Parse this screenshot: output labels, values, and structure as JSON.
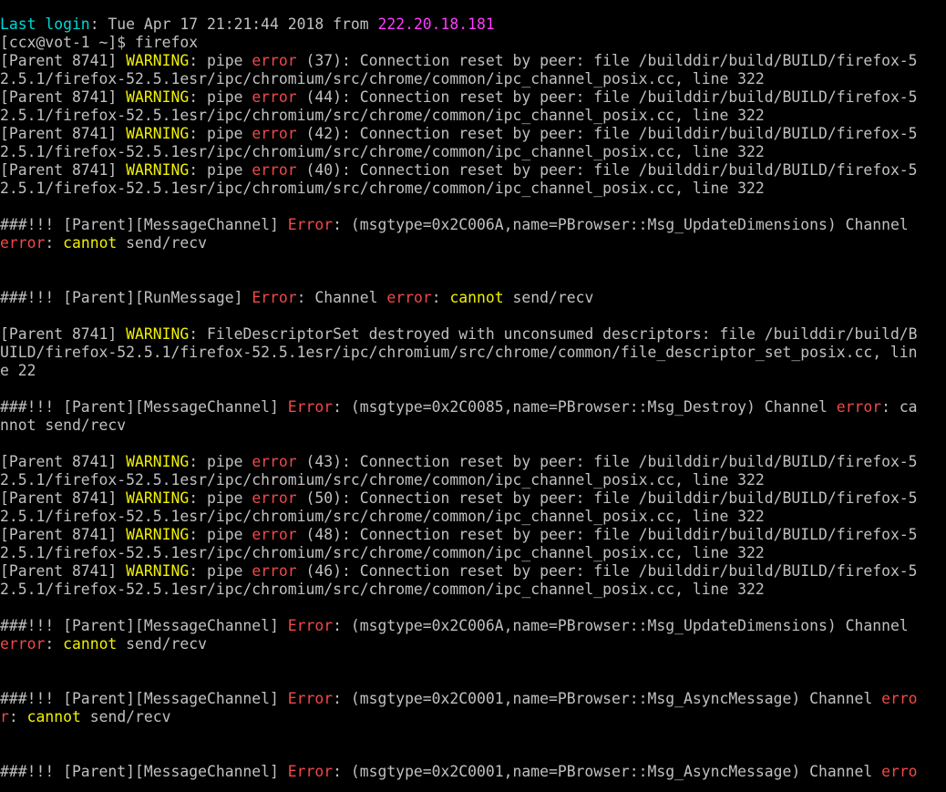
{
  "terminal": {
    "colors": {
      "default": "#c0c0c0",
      "cyan": "#00d7d7",
      "magenta": "#ff3cff",
      "yellow": "#f0f000",
      "red": "#f04848",
      "background": "#000000"
    },
    "lines": [
      [
        [
          "cyan",
          "Last login"
        ],
        [
          "default",
          ": Tue Apr 17 21:21:44 2018 from "
        ],
        [
          "magenta",
          "222.20.18.181"
        ]
      ],
      [
        [
          "default",
          "[ccx@vot-1 ~]$ firefox"
        ]
      ],
      [
        [
          "default",
          "[Parent 8741] "
        ],
        [
          "yellow",
          "WARNING"
        ],
        [
          "default",
          ": pipe "
        ],
        [
          "red",
          "error"
        ],
        [
          "default",
          " (37): Connection reset by peer: file /builddir/build/BUILD/firefox-5"
        ]
      ],
      [
        [
          "default",
          "2.5.1/firefox-52.5.1esr/ipc/chromium/src/chrome/common/ipc_channel_posix.cc, line 322"
        ]
      ],
      [
        [
          "default",
          "[Parent 8741] "
        ],
        [
          "yellow",
          "WARNING"
        ],
        [
          "default",
          ": pipe "
        ],
        [
          "red",
          "error"
        ],
        [
          "default",
          " (44): Connection reset by peer: file /builddir/build/BUILD/firefox-5"
        ]
      ],
      [
        [
          "default",
          "2.5.1/firefox-52.5.1esr/ipc/chromium/src/chrome/common/ipc_channel_posix.cc, line 322"
        ]
      ],
      [
        [
          "default",
          "[Parent 8741] "
        ],
        [
          "yellow",
          "WARNING"
        ],
        [
          "default",
          ": pipe "
        ],
        [
          "red",
          "error"
        ],
        [
          "default",
          " (42): Connection reset by peer: file /builddir/build/BUILD/firefox-5"
        ]
      ],
      [
        [
          "default",
          "2.5.1/firefox-52.5.1esr/ipc/chromium/src/chrome/common/ipc_channel_posix.cc, line 322"
        ]
      ],
      [
        [
          "default",
          "[Parent 8741] "
        ],
        [
          "yellow",
          "WARNING"
        ],
        [
          "default",
          ": pipe "
        ],
        [
          "red",
          "error"
        ],
        [
          "default",
          " (40): Connection reset by peer: file /builddir/build/BUILD/firefox-5"
        ]
      ],
      [
        [
          "default",
          "2.5.1/firefox-52.5.1esr/ipc/chromium/src/chrome/common/ipc_channel_posix.cc, line 322"
        ]
      ],
      [],
      [
        [
          "default",
          "###!!! [Parent][MessageChannel] "
        ],
        [
          "red",
          "Error"
        ],
        [
          "default",
          ": (msgtype=0x2C006A,name=PBrowser::Msg_UpdateDimensions) Channel "
        ]
      ],
      [
        [
          "red",
          "error"
        ],
        [
          "default",
          ": "
        ],
        [
          "yellow",
          "cannot"
        ],
        [
          "default",
          " send/recv"
        ]
      ],
      [],
      [],
      [
        [
          "default",
          "###!!! [Parent][RunMessage] "
        ],
        [
          "red",
          "Error"
        ],
        [
          "default",
          ": Channel "
        ],
        [
          "red",
          "error"
        ],
        [
          "default",
          ": "
        ],
        [
          "yellow",
          "cannot"
        ],
        [
          "default",
          " send/recv"
        ]
      ],
      [],
      [
        [
          "default",
          "[Parent 8741] "
        ],
        [
          "yellow",
          "WARNING"
        ],
        [
          "default",
          ": FileDescriptorSet destroyed with unconsumed descriptors: file /builddir/build/B"
        ]
      ],
      [
        [
          "default",
          "UILD/firefox-52.5.1/firefox-52.5.1esr/ipc/chromium/src/chrome/common/file_descriptor_set_posix.cc, lin"
        ]
      ],
      [
        [
          "default",
          "e 22"
        ]
      ],
      [],
      [
        [
          "default",
          "###!!! [Parent][MessageChannel] "
        ],
        [
          "red",
          "Error"
        ],
        [
          "default",
          ": (msgtype=0x2C0085,name=PBrowser::Msg_Destroy) Channel "
        ],
        [
          "red",
          "error"
        ],
        [
          "default",
          ": ca"
        ]
      ],
      [
        [
          "default",
          "nnot send/recv"
        ]
      ],
      [],
      [
        [
          "default",
          "[Parent 8741] "
        ],
        [
          "yellow",
          "WARNING"
        ],
        [
          "default",
          ": pipe "
        ],
        [
          "red",
          "error"
        ],
        [
          "default",
          " (43): Connection reset by peer: file /builddir/build/BUILD/firefox-5"
        ]
      ],
      [
        [
          "default",
          "2.5.1/firefox-52.5.1esr/ipc/chromium/src/chrome/common/ipc_channel_posix.cc, line 322"
        ]
      ],
      [
        [
          "default",
          "[Parent 8741] "
        ],
        [
          "yellow",
          "WARNING"
        ],
        [
          "default",
          ": pipe "
        ],
        [
          "red",
          "error"
        ],
        [
          "default",
          " (50): Connection reset by peer: file /builddir/build/BUILD/firefox-5"
        ]
      ],
      [
        [
          "default",
          "2.5.1/firefox-52.5.1esr/ipc/chromium/src/chrome/common/ipc_channel_posix.cc, line 322"
        ]
      ],
      [
        [
          "default",
          "[Parent 8741] "
        ],
        [
          "yellow",
          "WARNING"
        ],
        [
          "default",
          ": pipe "
        ],
        [
          "red",
          "error"
        ],
        [
          "default",
          " (48): Connection reset by peer: file /builddir/build/BUILD/firefox-5"
        ]
      ],
      [
        [
          "default",
          "2.5.1/firefox-52.5.1esr/ipc/chromium/src/chrome/common/ipc_channel_posix.cc, line 322"
        ]
      ],
      [
        [
          "default",
          "[Parent 8741] "
        ],
        [
          "yellow",
          "WARNING"
        ],
        [
          "default",
          ": pipe "
        ],
        [
          "red",
          "error"
        ],
        [
          "default",
          " (46): Connection reset by peer: file /builddir/build/BUILD/firefox-5"
        ]
      ],
      [
        [
          "default",
          "2.5.1/firefox-52.5.1esr/ipc/chromium/src/chrome/common/ipc_channel_posix.cc, line 322"
        ]
      ],
      [],
      [
        [
          "default",
          "###!!! [Parent][MessageChannel] "
        ],
        [
          "red",
          "Error"
        ],
        [
          "default",
          ": (msgtype=0x2C006A,name=PBrowser::Msg_UpdateDimensions) Channel "
        ]
      ],
      [
        [
          "red",
          "error"
        ],
        [
          "default",
          ": "
        ],
        [
          "yellow",
          "cannot"
        ],
        [
          "default",
          " send/recv"
        ]
      ],
      [],
      [],
      [
        [
          "default",
          "###!!! [Parent][MessageChannel] "
        ],
        [
          "red",
          "Error"
        ],
        [
          "default",
          ": (msgtype=0x2C0001,name=PBrowser::Msg_AsyncMessage) Channel "
        ],
        [
          "red",
          "erro"
        ]
      ],
      [
        [
          "red",
          "r"
        ],
        [
          "default",
          ": "
        ],
        [
          "yellow",
          "cannot"
        ],
        [
          "default",
          " send/recv"
        ]
      ],
      [],
      [],
      [
        [
          "default",
          "###!!! [Parent][MessageChannel] "
        ],
        [
          "red",
          "Error"
        ],
        [
          "default",
          ": (msgtype=0x2C0001,name=PBrowser::Msg_AsyncMessage) Channel "
        ],
        [
          "red",
          "erro"
        ]
      ]
    ]
  }
}
